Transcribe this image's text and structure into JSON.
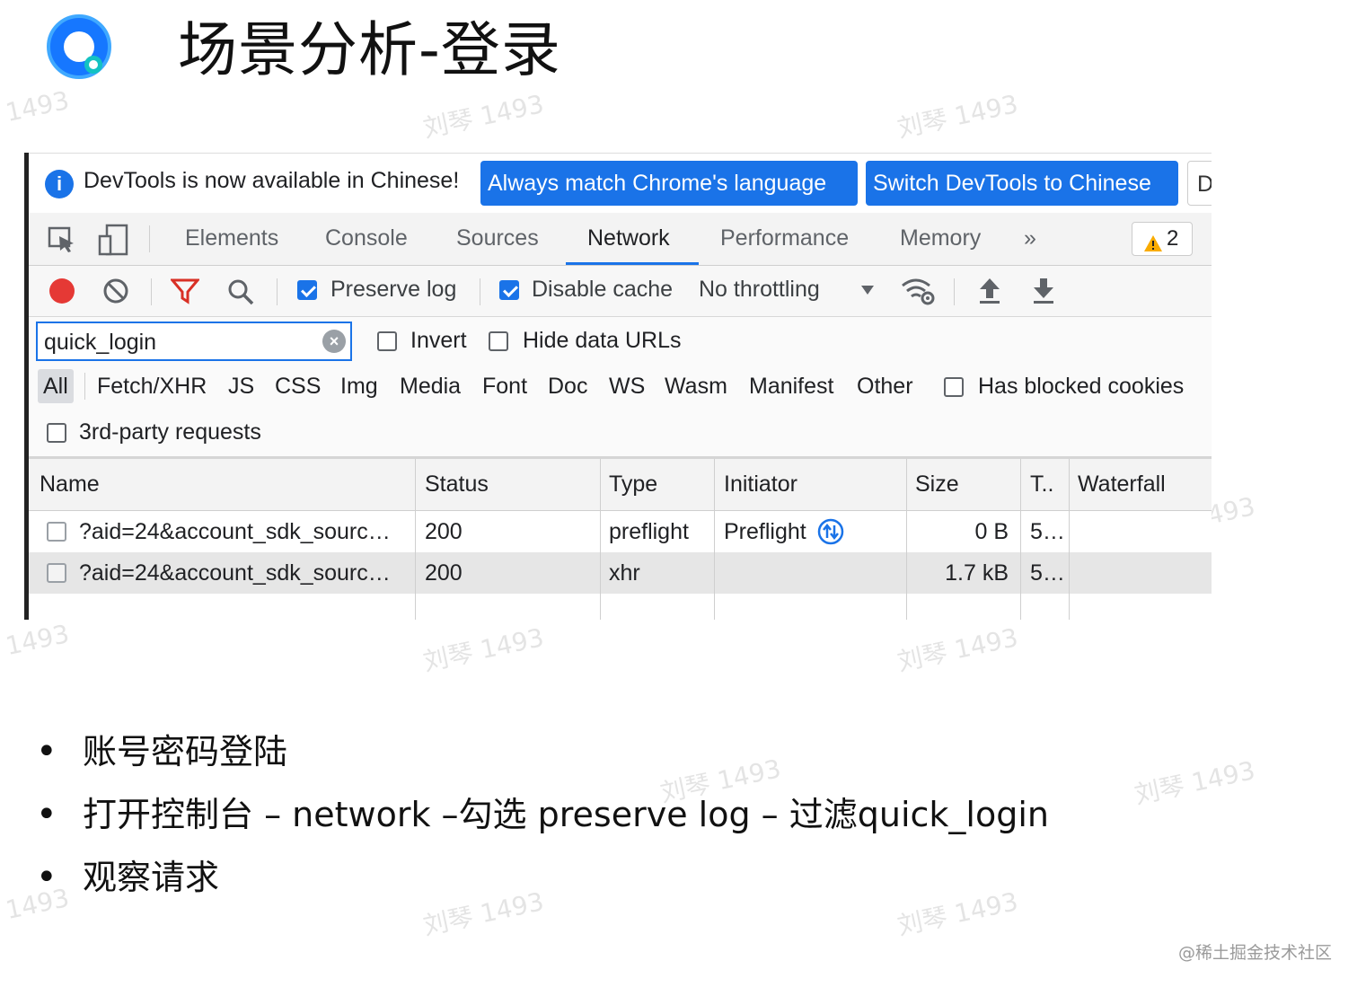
{
  "slide": {
    "title": "场景分析-登录",
    "watermark": "刘琴 1493",
    "watermark_number": "1493"
  },
  "devtools": {
    "infobar": {
      "info_icon": "info-icon",
      "message": "DevTools is now available in Chinese!",
      "btn_match": "Always match Chrome's language",
      "btn_switch": "Switch DevTools to Chinese",
      "btn_more": "D"
    },
    "tabs": [
      "Elements",
      "Console",
      "Sources",
      "Network",
      "Performance",
      "Memory"
    ],
    "active_tab": "Network",
    "more_tabs": "»",
    "warnings": {
      "icon": "warning-icon",
      "count": "2"
    },
    "network_toolbar": {
      "record_icon": "record-icon",
      "clear_icon": "clear-icon",
      "filter_icon": "filter-icon",
      "search_icon": "search-icon",
      "preserve_log": {
        "label": "Preserve log",
        "checked": true
      },
      "disable_cache": {
        "label": "Disable cache",
        "checked": true
      },
      "throttling": "No throttling",
      "network_conditions_icon": "wifi-settings-icon",
      "import_icon": "upload-icon",
      "export_icon": "download-icon"
    },
    "filter": {
      "value": "quick_login",
      "invert": {
        "label": "Invert",
        "checked": false
      },
      "hide_data_urls": {
        "label": "Hide data URLs",
        "checked": false
      },
      "types": [
        "All",
        "Fetch/XHR",
        "JS",
        "CSS",
        "Img",
        "Media",
        "Font",
        "Doc",
        "WS",
        "Wasm",
        "Manifest",
        "Other"
      ],
      "selected_type": "All",
      "blocked_cookies": {
        "label": "Has blocked cookies",
        "checked": false
      },
      "third_party": {
        "label": "3rd-party requests",
        "checked": false
      }
    },
    "table": {
      "columns": [
        "Name",
        "Status",
        "Type",
        "Initiator",
        "Size",
        "T..",
        "Waterfall"
      ],
      "rows": [
        {
          "name": "?aid=24&account_sdk_sourc…",
          "status": "200",
          "type": "preflight",
          "initiator": "Preflight",
          "size": "0 B",
          "time": "5…"
        },
        {
          "name": "?aid=24&account_sdk_sourc…",
          "status": "200",
          "type": "xhr",
          "initiator": "",
          "size": "1.7 kB",
          "time": "5…"
        }
      ]
    }
  },
  "bullets": [
    "账号密码登陆",
    "打开控制台 – network –勾选 preserve log – 过滤quick_login",
    "观察请求"
  ],
  "credit": "@稀土掘金技术社区",
  "colors": {
    "accent": "#1a73e8",
    "record": "#e53935",
    "filter": "#d93025",
    "warning": "#f9ab00"
  }
}
